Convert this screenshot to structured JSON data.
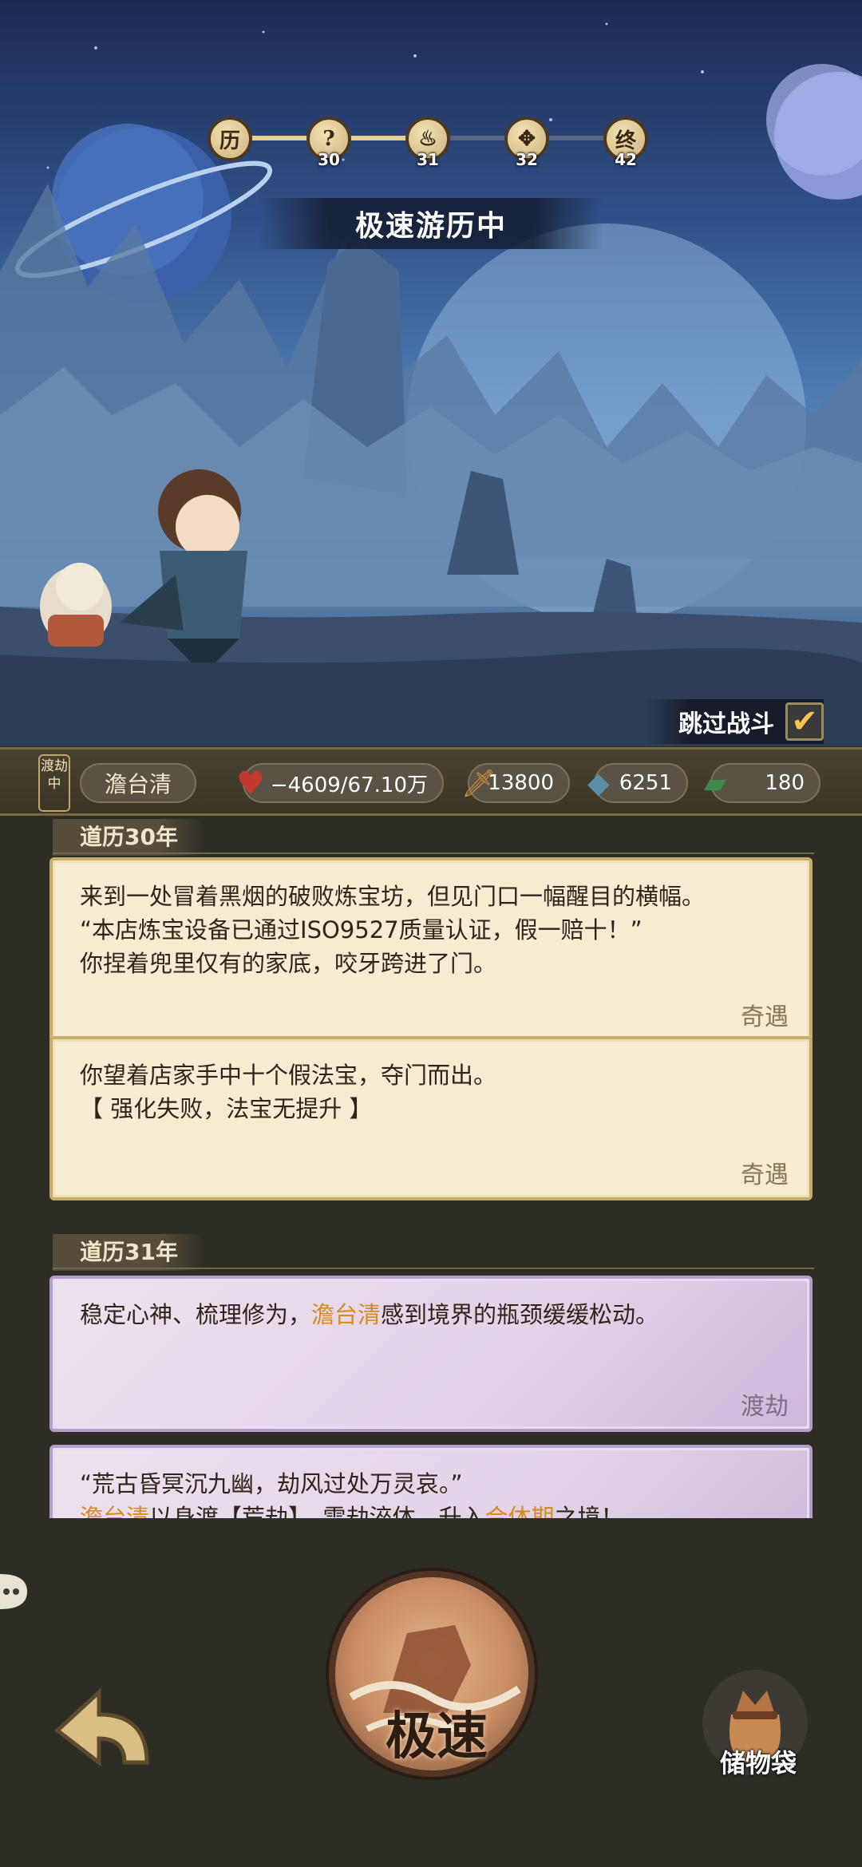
{
  "progress": {
    "nodes": [
      {
        "glyph": "历",
        "num": ""
      },
      {
        "glyph": "?",
        "num": "30"
      },
      {
        "glyph": "♨",
        "num": "31"
      },
      {
        "glyph": "✥",
        "num": "32"
      },
      {
        "glyph": "终",
        "num": "42"
      }
    ]
  },
  "status_banner": "极速游历中",
  "skip_battle": {
    "label": "跳过战斗",
    "checked_mark": "✔"
  },
  "status_bar": {
    "state_tag": "渡劫中",
    "character_name": "澹台清",
    "hp": "−4609/67.10万",
    "sword_value": "13800",
    "stone_value": "6251",
    "jade_value": "180",
    "icons": {
      "hp": "heart-icon",
      "sword": "sword-icon",
      "stone": "spirit-stone-icon",
      "jade": "jade-icon"
    },
    "colors": {
      "hp": "#c23a2c",
      "sword": "#d8933b",
      "stone": "#5b8fa8",
      "jade": "#3e8a4a"
    }
  },
  "log": {
    "year30": {
      "title": "道历30年",
      "entries": [
        {
          "lines": [
            "来到一处冒着黑烟的破败炼宝坊，但见门口一幅醒目的横幅。",
            "“本店炼宝设备已通过ISO9527质量认证，假一赔十！”",
            "你捏着兜里仅有的家底，咬牙跨进了门。"
          ],
          "tag": "奇遇"
        },
        {
          "lines": [
            "你望着店家手中十个假法宝，夺门而出。",
            "【 强化失败，法宝无提升 】"
          ],
          "tag": "奇遇"
        }
      ]
    },
    "year31": {
      "title": "道历31年",
      "entries": [
        {
          "before": "稳定心神、梳理修为，",
          "highlight": "澹台清",
          "after": "感到境界的瓶颈缓缓松动。",
          "tag": "渡劫"
        },
        {
          "line1": "“荒古昏冥沉九幽，劫风过处万灵哀。”",
          "line2_a": "澹台清",
          "line2_b": "以身渡【荒劫】，雷劫淬体，升入",
          "line2_c": "合体期",
          "line2_d": "之境！"
        }
      ]
    }
  },
  "bottom": {
    "speed_label": "极速",
    "bag_label": "储物袋"
  }
}
